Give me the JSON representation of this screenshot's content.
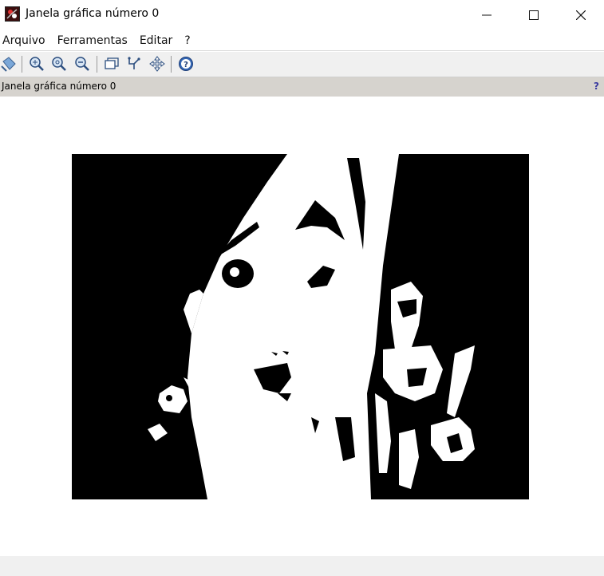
{
  "window": {
    "title": "Janela gráfica número 0",
    "minimize_icon": "minimize-icon",
    "maximize_icon": "maximize-icon",
    "close_icon": "close-icon"
  },
  "menu": {
    "items": [
      "Arquivo",
      "Ferramentas",
      "Editar",
      "?"
    ]
  },
  "toolbar": {
    "icons": [
      "select-icon",
      "zoom-fit-icon",
      "zoom-in-icon",
      "zoom-out-icon",
      "window-icon",
      "rotate-icon",
      "pan-icon",
      "help-icon"
    ]
  },
  "panel": {
    "title": "Janela gráfica número 0",
    "help_label": "?"
  },
  "image": {
    "description_icon": "binary-image"
  },
  "colors": {
    "panel_header": "#d6d3ce",
    "toolbar": "#f0f0f0",
    "image_background": "#000000",
    "help_accent": "#3a3aa0"
  }
}
